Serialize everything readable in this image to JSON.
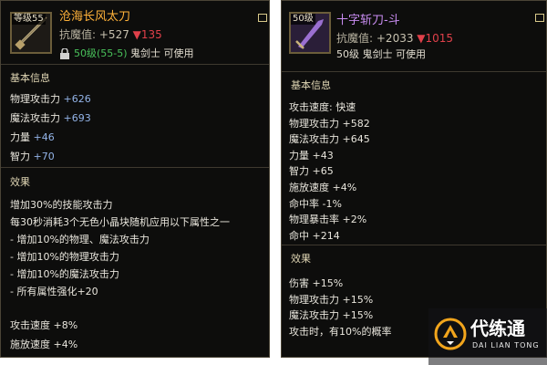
{
  "left": {
    "level_badge": "等级55",
    "name": "沧海长风太刀",
    "name_color": "#ffb23a",
    "score_label": "抗魔值:",
    "score_up": "+527",
    "score_down": "▼135",
    "req_level": "50级(55-5)",
    "req_class": "鬼剑士 可使用",
    "basic_title": "基本信息",
    "stats": [
      {
        "label": "物理攻击力",
        "value": "+626"
      },
      {
        "label": "魔法攻击力",
        "value": "+693"
      },
      {
        "label": "力量",
        "value": "+46"
      },
      {
        "label": "智力",
        "value": "+70"
      }
    ],
    "effect_title": "效果",
    "effects": [
      "增加30%的技能攻击力",
      "每30秒消耗3个无色小晶块随机应用以下属性之一",
      "- 增加10%的物理、魔法攻击力",
      "- 增加10%的物理攻击力",
      "- 增加10%的魔法攻击力",
      "- 所有属性强化+20"
    ],
    "extra": [
      "攻击速度 +8%",
      "施放速度 +4%"
    ]
  },
  "right": {
    "level_badge": "50级",
    "name": "十字斩刀-斗",
    "name_color": "#c88cf0",
    "score_label": "抗魔值:",
    "score_up": "+2033",
    "score_down": "▼1015",
    "req_text": "50级 鬼剑士 可使用",
    "basic_title": "基本信息",
    "stats": [
      "攻击速度: 快速",
      "物理攻击力 +582",
      "魔法攻击力 +645",
      "力量 +43",
      "智力 +65",
      "施放速度 +4%",
      "命中率 -1%",
      "物理暴击率 +2%",
      "命中 +214"
    ],
    "effect_title": "效果",
    "effects": [
      "伤害 +15%",
      "物理攻击力 +15%",
      "魔法攻击力 +15%",
      "攻击时，有10%的概率"
    ]
  },
  "logo": {
    "title": "代练通",
    "subtitle": "DAI LIAN TONG"
  }
}
